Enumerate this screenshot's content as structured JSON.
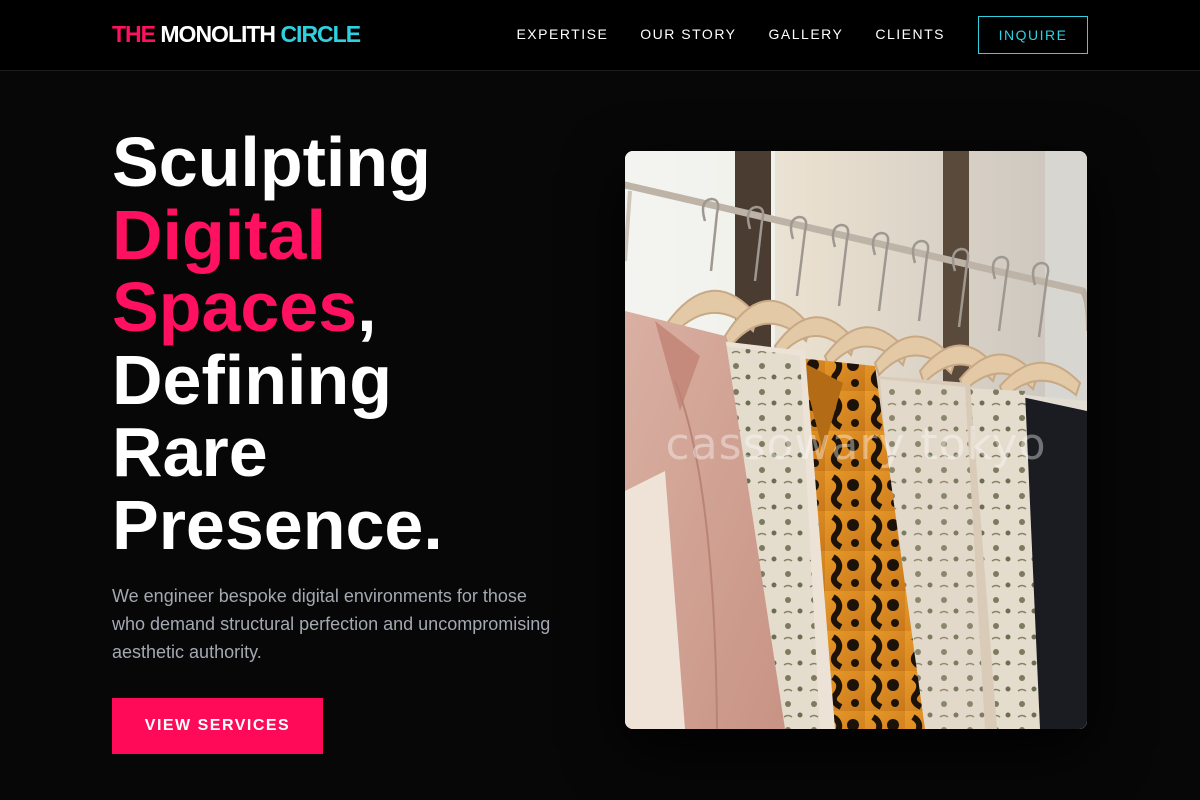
{
  "brand": {
    "part1": "THE",
    "part2": "MONOLITH",
    "part3": "CIRCLE"
  },
  "nav": {
    "items": [
      "EXPERTISE",
      "OUR STORY",
      "GALLERY",
      "CLIENTS"
    ],
    "cta_label": "INQUIRE"
  },
  "hero": {
    "line1": "Sculpting",
    "line2": "Digital",
    "line3_accent": "Spaces",
    "line3_rest": ",",
    "line4": "Defining",
    "line5": "Rare",
    "line6": "Presence.",
    "subtitle": "We engineer bespoke digital environments for those who demand structural perfection and uncompromising aesthetic authority.",
    "button_label": "VIEW SERVICES"
  },
  "image": {
    "watermark": "cassowary tokyo"
  },
  "colors": {
    "accent_pink": "#ff1060",
    "accent_cyan": "#2fd1e0",
    "background": "#070707"
  }
}
